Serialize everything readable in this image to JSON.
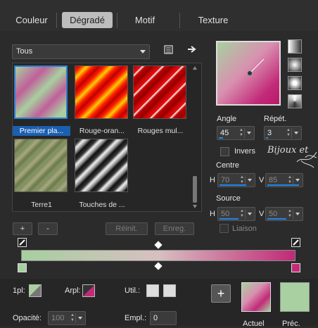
{
  "tabs": [
    "Couleur",
    "Dégradé",
    "Motif",
    "Texture"
  ],
  "category": "Tous",
  "thumbnails": [
    {
      "label": "Premier pla..."
    },
    {
      "label": "Rouge-oran..."
    },
    {
      "label": "Rouges mul..."
    },
    {
      "label": "Terre1"
    },
    {
      "label": "Touches de ..."
    }
  ],
  "buttons": {
    "add": "+",
    "remove": "-",
    "reset": "Réinit.",
    "save": "Enreg."
  },
  "angle": {
    "label": "Angle",
    "value": "45"
  },
  "repeat": {
    "label": "Répét.",
    "value": "3"
  },
  "invert": {
    "label": "Invers"
  },
  "watermark": "Bijoux et",
  "center": {
    "label": "Centre",
    "h_label": "H",
    "h": "70",
    "v_label": "V",
    "v": "85"
  },
  "source": {
    "label": "Source",
    "h_label": "H",
    "h": "50",
    "v_label": "V",
    "v": "50"
  },
  "link": {
    "label": "Liaison"
  },
  "bottom": {
    "fg_label": "1pl:",
    "bg_label": "Arpl:",
    "use_label": "Util.:",
    "opacity_label": "Opacité:",
    "opacity": "100",
    "location_label": "Empl.:",
    "location": "0",
    "plus": "+",
    "current_label": "Actuel",
    "previous_label": "Préc."
  },
  "colors": {
    "pink": "#c22a78",
    "green": "#a8d0a0",
    "accent": "#1b5fb0"
  }
}
